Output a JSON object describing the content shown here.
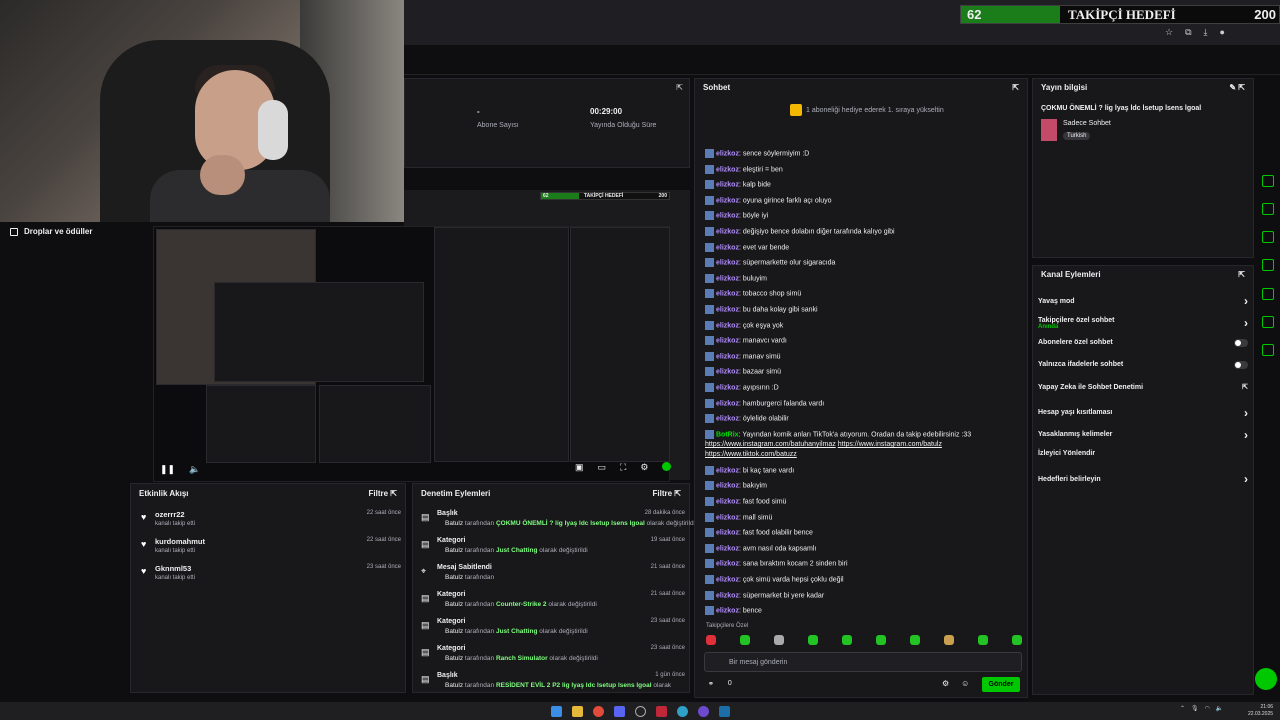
{
  "overlay": {
    "goal_current": "62",
    "goal_label": "TAKİPÇİ HEDEFİ",
    "goal_target": "200",
    "goal_progress": 0.31,
    "drops_label": "Droplar ve ödüller"
  },
  "stats": {
    "subs_value": "-",
    "subs_label": "Abone Sayısı",
    "time_value": "00:29:00",
    "time_label": "Yayında Olduğu Süre"
  },
  "preview": {
    "goal_current": "62",
    "goal_label": "TAKİPÇİ HEDEFİ",
    "goal_target": "200"
  },
  "activity": {
    "title": "Etkinlik Akışı",
    "filter": "Filtre",
    "items": [
      {
        "user": "ozerrr22",
        "action": "kanalı takip etti",
        "time": "22 saat önce"
      },
      {
        "user": "kurdomahmut",
        "action": "kanalı takip etti",
        "time": "22 saat önce"
      },
      {
        "user": "Gknnml53",
        "action": "kanalı takip etti",
        "time": "23 saat önce"
      }
    ]
  },
  "moderation": {
    "title": "Denetim Eylemleri",
    "filter": "Filtre",
    "items": [
      {
        "title": "Başlık",
        "user": "Batulz",
        "mid": " tarafından ",
        "value": "ÇOKMU ÖNEMLİ ? lig lyaş ldc lsetup lsens lgoal",
        "end": " olarak değiştirildi",
        "time": "28 dakika önce"
      },
      {
        "title": "Kategori",
        "user": "Batulz",
        "mid": " tarafından ",
        "value": "Just Chatting",
        "end": " olarak değiştirildi",
        "time": "19 saat önce"
      },
      {
        "title": "Mesaj Sabitlendi",
        "user": "Batulz",
        "mid": " tarafından",
        "value": "",
        "end": "",
        "time": "21 saat önce"
      },
      {
        "title": "Kategori",
        "user": "Batulz",
        "mid": " tarafından ",
        "value": "Counter-Strike 2",
        "end": " olarak değiştirildi",
        "time": "21 saat önce"
      },
      {
        "title": "Kategori",
        "user": "Batulz",
        "mid": " tarafından ",
        "value": "Just Chatting",
        "end": " olarak değiştirildi",
        "time": "23 saat önce"
      },
      {
        "title": "Kategori",
        "user": "Batulz",
        "mid": " tarafından ",
        "value": "Ranch Simulator",
        "end": " olarak değiştirildi",
        "time": "23 saat önce"
      },
      {
        "title": "Başlık",
        "user": "Batulz",
        "mid": " tarafından ",
        "value": "RESİDENT EVİL 2 P2 lig lyaş ldc lsetup lsens lgoal",
        "end": " olarak",
        "time": "1 gün önce"
      }
    ]
  },
  "chat": {
    "title": "Sohbet",
    "gift_text": "1 aboneliği hediye ederek 1. sıraya yükseltin",
    "messages": [
      {
        "user": "elizkoz",
        "text": ": sence söylermiyim :D"
      },
      {
        "user": "elizkoz",
        "text": ": eleştiri = ben"
      },
      {
        "user": "elizkoz",
        "text": ": kalp bide"
      },
      {
        "user": "elizkoz",
        "text": ": oyuna girince farklı açı oluyo"
      },
      {
        "user": "elizkoz",
        "text": ": böyle iyi"
      },
      {
        "user": "elizkoz",
        "text": ": değişiyo bence dolabın diğer tarafında kalıyo gibi"
      },
      {
        "user": "elizkoz",
        "text": ": evet var bende"
      },
      {
        "user": "elizkoz",
        "text": ": süpermarkette olur sigaracıda"
      },
      {
        "user": "elizkoz",
        "text": ": buluyim"
      },
      {
        "user": "elizkoz",
        "text": ": tobacco shop simü"
      },
      {
        "user": "elizkoz",
        "text": ": bu daha kolay gibi sanki"
      },
      {
        "user": "elizkoz",
        "text": ": çok eşya yok"
      },
      {
        "user": "elizkoz",
        "text": ": manavcı vardı"
      },
      {
        "user": "elizkoz",
        "text": ": manav simü"
      },
      {
        "user": "elizkoz",
        "text": ": bazaar simü"
      },
      {
        "user": "elizkoz",
        "text": ": ayıpsırın :D"
      },
      {
        "user": "elizkoz",
        "text": ": hamburgerci falanda vardı"
      },
      {
        "user": "elizkoz",
        "text": ": öylelide olabilir"
      }
    ],
    "bot_user": "BotRix",
    "bot_text": ": Yayından komik anları TikTok'a atıyorum. Oradan da takip edebilirsiniz :33",
    "bot_link1": "https://www.instagram.com/batuhanyilmaz",
    "bot_link2": "https://www.instagram.com/batulz",
    "bot_link3": "https://www.tiktok.com/batuzz",
    "messages2": [
      {
        "user": "elizkoz",
        "text": ": bi kaç tane vardı"
      },
      {
        "user": "elizkoz",
        "text": ": bakıyim"
      },
      {
        "user": "elizkoz",
        "text": ": fast food simü"
      },
      {
        "user": "elizkoz",
        "text": ": mall simü"
      },
      {
        "user": "elizkoz",
        "text": ": fast food olabilir bence"
      },
      {
        "user": "elizkoz",
        "text": ": avm nasıl oda kapsamlı"
      },
      {
        "user": "elizkoz",
        "text": ": sana bıraktım kocam 2 sinden biri"
      },
      {
        "user": "elizkoz",
        "text": ": çok simü varda hepsi çoklu değil"
      },
      {
        "user": "elizkoz",
        "text": ": süpermarket bi yere kadar"
      },
      {
        "user": "elizkoz",
        "text": ": bence"
      }
    ],
    "followers_only": "Takipçilere Özel",
    "input_placeholder": "Bir mesaj gönderin",
    "count": "0",
    "send": "Gönder"
  },
  "stream_info": {
    "title": "Yayın bilgisi",
    "stream_title": "ÇOKMU ÖNEMLİ ? lig lyaş ldc lsetup lsens lgoal",
    "category": "Sadece Sohbet",
    "tag": "Turkish"
  },
  "channel_actions": {
    "title": "Kanal Eylemleri",
    "items": [
      {
        "label": "Yavaş mod",
        "kind": "chevron"
      },
      {
        "label": "Takipçilere özel sohbet",
        "sub": "Anında",
        "kind": "chevron"
      },
      {
        "label": "Abonelere özel sohbet",
        "kind": "toggle"
      },
      {
        "label": "Yalnızca ifadelerle sohbet",
        "kind": "toggle"
      },
      {
        "label": "Yapay Zeka ile Sohbet Denetimi",
        "kind": "external"
      },
      {
        "label": "Hesap yaşı kısıtlaması",
        "kind": "chevron"
      },
      {
        "label": "Yasaklanmış kelimeler",
        "kind": "chevron"
      },
      {
        "label": "İzleyici Yönlendir",
        "kind": "none"
      },
      {
        "label": "Hedefleri belirleyin",
        "kind": "chevron"
      }
    ]
  },
  "clock": {
    "time": "21:06",
    "date": "22.03.2025"
  },
  "colors": {
    "accent": "#00c800",
    "username": "#b28cff",
    "bg": "#0e0e10",
    "panel": "#18181b"
  }
}
